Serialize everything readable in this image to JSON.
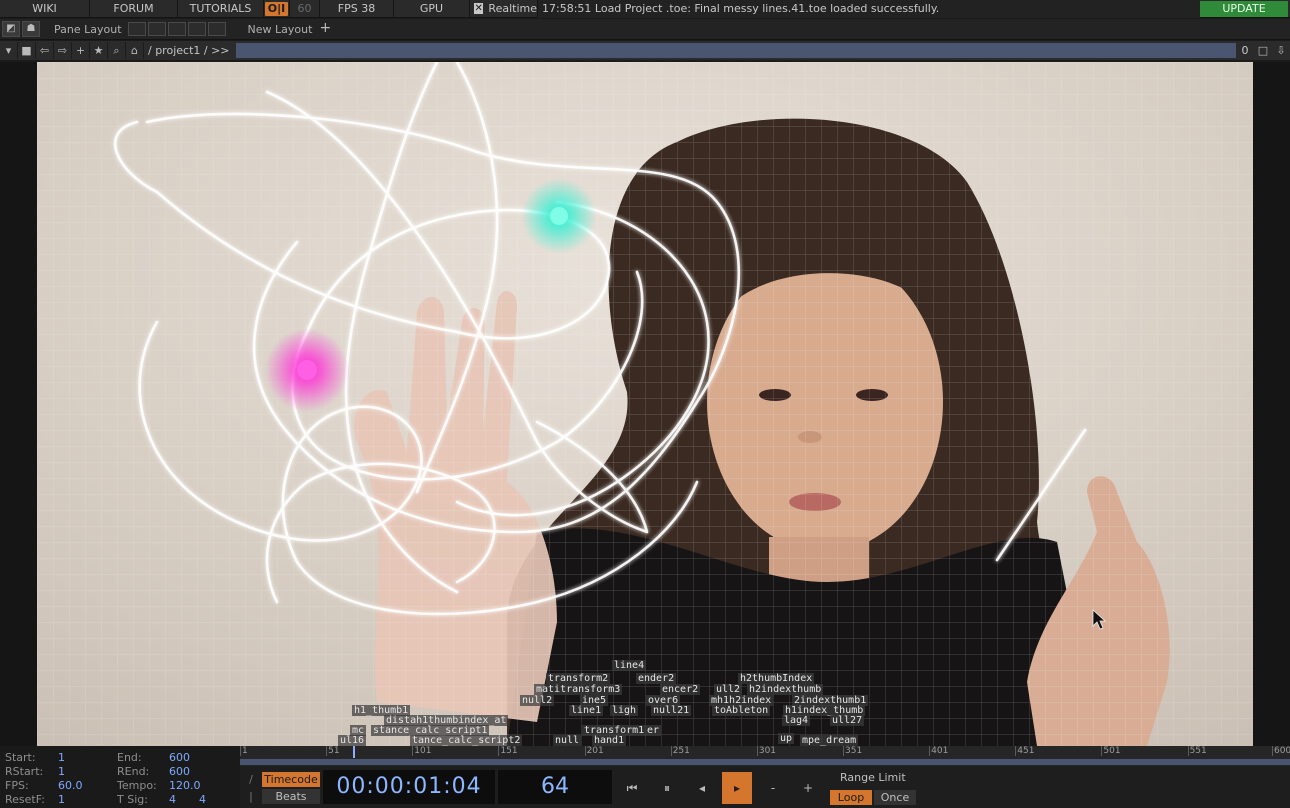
{
  "topbar": {
    "wiki": "WIKI",
    "forum": "FORUM",
    "tutorials": "TUTORIALS",
    "oi": "O|I",
    "sixty": "60",
    "fps": "FPS  38",
    "gpu": "GPU",
    "realtime": "Realtime",
    "log": "17:58:51 Load Project .toe: Final messy lines.41.toe loaded successfully.",
    "update": "UPDATE"
  },
  "layoutbar": {
    "pane_layout": "Pane Layout",
    "new_layout": "New Layout"
  },
  "pathbar": {
    "path": "/ project1 / >>",
    "zero": "0"
  },
  "nodes": [
    {
      "label": "line4"
    },
    {
      "label": "transform2"
    },
    {
      "label": "ender2"
    },
    {
      "label": "h2thumbIndex"
    },
    {
      "label": "matitransform3"
    },
    {
      "label": "encer2"
    },
    {
      "label": "ull2"
    },
    {
      "label": "h2indexthumb"
    },
    {
      "label": "null2"
    },
    {
      "label": "ine5"
    },
    {
      "label": "over6"
    },
    {
      "label": "mh1h2index"
    },
    {
      "label": "2indexthumb1"
    },
    {
      "label": "h1_thumb1"
    },
    {
      "label": "line1"
    },
    {
      "label": "ligh"
    },
    {
      "label": "null21"
    },
    {
      "label": "toAbleton"
    },
    {
      "label": "h1index_thumb"
    },
    {
      "label": "distah1thumbindex_at"
    },
    {
      "label": "lag4"
    },
    {
      "label": "ull27"
    },
    {
      "label": "transform1"
    },
    {
      "label": "er"
    },
    {
      "label": "mc"
    },
    {
      "label": "stance_calc_script1"
    },
    {
      "label": "ul16"
    },
    {
      "label": "tance_calc_script2"
    },
    {
      "label": "null"
    },
    {
      "label": "hand1"
    },
    {
      "label": "up"
    },
    {
      "label": "mpe_dream"
    }
  ],
  "range": {
    "start_label": "Start:",
    "start": "1",
    "end_label": "End:",
    "end": "600",
    "rstart_label": "RStart:",
    "rstart": "1",
    "rend_label": "REnd:",
    "rend": "600",
    "fps_label": "FPS:",
    "fps": "60.0",
    "tempo_label": "Tempo:",
    "tempo": "120.0",
    "resetf_label": "ResetF:",
    "resetf": "1",
    "tsig_label": "T Sig:",
    "tsig_a": "4",
    "tsig_b": "4"
  },
  "timeline": {
    "ticks": [
      "1",
      "51",
      "101",
      "151",
      "201",
      "251",
      "301",
      "351",
      "401",
      "451",
      "501",
      "551",
      "600"
    ],
    "current_frame": 64
  },
  "controls": {
    "timecode": "Timecode",
    "beats": "Beats",
    "timecode_value": "00:00:01:04",
    "frame_value": "64",
    "range_limit": "Range Limit",
    "loop": "Loop",
    "once": "Once",
    "minus": "-",
    "plus": "+"
  },
  "colors": {
    "accent_orange": "#d4762e",
    "update_green": "#2f8a3a",
    "value_blue": "#8eb7ff",
    "magenta_glow": "#ff2bd6",
    "cyan_glow": "#2bf0d2"
  }
}
